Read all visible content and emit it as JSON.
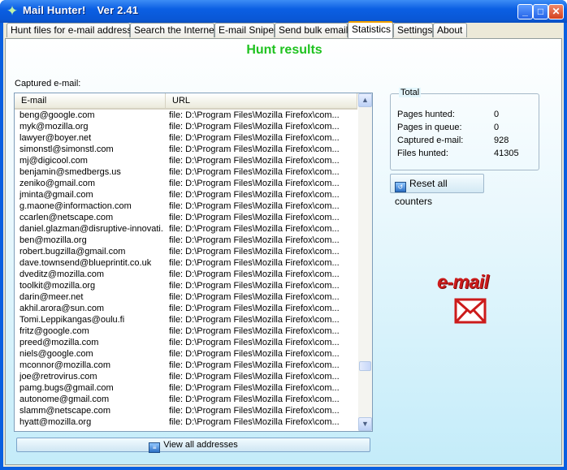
{
  "window": {
    "title": "Mail Hunter!",
    "version": "Ver 2.41",
    "minimize": "_",
    "maximize": "□",
    "close": "✕"
  },
  "tabs": [
    {
      "label": "Hunt files for e-mail addresses"
    },
    {
      "label": "Search the Internet"
    },
    {
      "label": "E-mail Sniper"
    },
    {
      "label": "Send bulk emails"
    },
    {
      "label": "Statistics"
    },
    {
      "label": "Settings"
    },
    {
      "label": "About"
    }
  ],
  "active_tab": "Statistics",
  "statistics": {
    "heading": "Hunt results",
    "captured_label": "Captured e-mail:",
    "columns": {
      "email": "E-mail",
      "url": "URL"
    },
    "rows": [
      {
        "email": "beng@google.com",
        "url": "file: D:\\Program Files\\Mozilla Firefox\\com..."
      },
      {
        "email": "myk@mozilla.org",
        "url": "file: D:\\Program Files\\Mozilla Firefox\\com..."
      },
      {
        "email": "lawyer@boyer.net",
        "url": "file: D:\\Program Files\\Mozilla Firefox\\com..."
      },
      {
        "email": "simonstl@simonstl.com",
        "url": "file: D:\\Program Files\\Mozilla Firefox\\com..."
      },
      {
        "email": "mj@digicool.com",
        "url": "file: D:\\Program Files\\Mozilla Firefox\\com..."
      },
      {
        "email": "benjamin@smedbergs.us",
        "url": "file: D:\\Program Files\\Mozilla Firefox\\com..."
      },
      {
        "email": "zeniko@gmail.com",
        "url": "file: D:\\Program Files\\Mozilla Firefox\\com..."
      },
      {
        "email": "jminta@gmail.com",
        "url": "file: D:\\Program Files\\Mozilla Firefox\\com..."
      },
      {
        "email": "g.maone@informaction.com",
        "url": "file: D:\\Program Files\\Mozilla Firefox\\com..."
      },
      {
        "email": "ccarlen@netscape.com",
        "url": "file: D:\\Program Files\\Mozilla Firefox\\com..."
      },
      {
        "email": "daniel.glazman@disruptive-innovati...",
        "url": "file: D:\\Program Files\\Mozilla Firefox\\com..."
      },
      {
        "email": "ben@mozilla.org",
        "url": "file: D:\\Program Files\\Mozilla Firefox\\com..."
      },
      {
        "email": "robert.bugzilla@gmail.com",
        "url": "file: D:\\Program Files\\Mozilla Firefox\\com..."
      },
      {
        "email": "dave.townsend@blueprintit.co.uk",
        "url": "file: D:\\Program Files\\Mozilla Firefox\\com..."
      },
      {
        "email": "dveditz@mozilla.com",
        "url": "file: D:\\Program Files\\Mozilla Firefox\\com..."
      },
      {
        "email": "toolkit@mozilla.org",
        "url": "file: D:\\Program Files\\Mozilla Firefox\\com..."
      },
      {
        "email": "darin@meer.net",
        "url": "file: D:\\Program Files\\Mozilla Firefox\\com..."
      },
      {
        "email": "akhil.arora@sun.com",
        "url": "file: D:\\Program Files\\Mozilla Firefox\\com..."
      },
      {
        "email": "Tomi.Leppikangas@oulu.fi",
        "url": "file: D:\\Program Files\\Mozilla Firefox\\com..."
      },
      {
        "email": "fritz@google.com",
        "url": "file: D:\\Program Files\\Mozilla Firefox\\com..."
      },
      {
        "email": "preed@mozilla.com",
        "url": "file: D:\\Program Files\\Mozilla Firefox\\com..."
      },
      {
        "email": "niels@google.com",
        "url": "file: D:\\Program Files\\Mozilla Firefox\\com..."
      },
      {
        "email": "mconnor@mozilla.com",
        "url": "file: D:\\Program Files\\Mozilla Firefox\\com..."
      },
      {
        "email": "joe@retrovirus.com",
        "url": "file: D:\\Program Files\\Mozilla Firefox\\com..."
      },
      {
        "email": "pamg.bugs@gmail.com",
        "url": "file: D:\\Program Files\\Mozilla Firefox\\com..."
      },
      {
        "email": "autonome@gmail.com",
        "url": "file: D:\\Program Files\\Mozilla Firefox\\com..."
      },
      {
        "email": "slamm@netscape.com",
        "url": "file: D:\\Program Files\\Mozilla Firefox\\com..."
      },
      {
        "email": "hyatt@mozilla.org",
        "url": "file: D:\\Program Files\\Mozilla Firefox\\com..."
      }
    ],
    "view_all_label": "View all addresses",
    "total": {
      "title": "Total",
      "pages_hunted_label": "Pages hunted:",
      "pages_hunted": "0",
      "pages_in_queue_label": "Pages in queue:",
      "pages_in_queue": "0",
      "captured_email_label": "Captured e-mail:",
      "captured_email": "928",
      "files_hunted_label": "Files hunted:",
      "files_hunted": "41305"
    },
    "reset_label": "Reset all counters",
    "logo_text": "e-mail"
  },
  "icons": {
    "app": "sparkle-icon",
    "view_all": "list-icon",
    "reset": "reset-icon",
    "envelope": "envelope-icon"
  },
  "colors": {
    "heading": "#1fc21f",
    "logo": "#cc1b1b",
    "titlebar": "#0a5fe0"
  }
}
